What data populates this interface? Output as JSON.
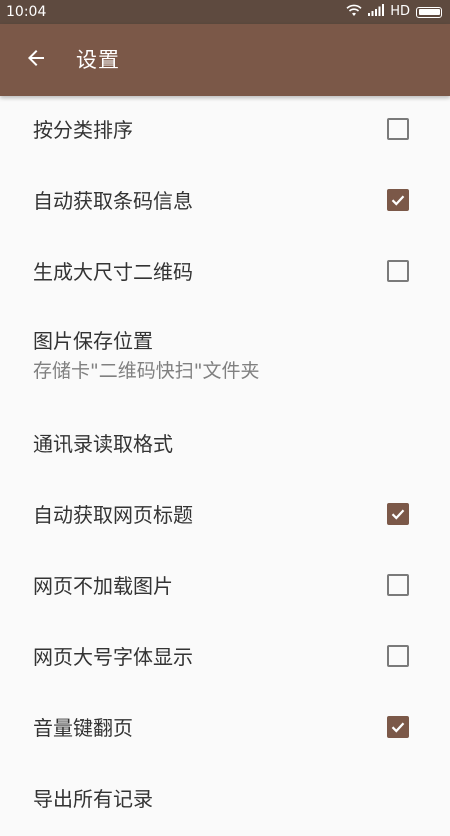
{
  "status_bar": {
    "time": "10:04",
    "network": "HD"
  },
  "app_bar": {
    "title": "设置",
    "back_icon": "arrow-back-icon"
  },
  "colors": {
    "accent": "#7b5848",
    "status_bar": "#5e4a3f",
    "background": "#fafafa"
  },
  "settings": [
    {
      "label": "按分类排序",
      "checked": false
    },
    {
      "label": "自动获取条码信息",
      "checked": true
    },
    {
      "label": "生成大尺寸二维码",
      "checked": false
    },
    {
      "label": "图片保存位置",
      "sub": "存储卡\"二维码快扫\"文件夹"
    },
    {
      "label": "通讯录读取格式"
    },
    {
      "label": "自动获取网页标题",
      "checked": true
    },
    {
      "label": "网页不加载图片",
      "checked": false
    },
    {
      "label": "网页大号字体显示",
      "checked": false
    },
    {
      "label": "音量键翻页",
      "checked": true
    },
    {
      "label": "导出所有记录"
    }
  ]
}
